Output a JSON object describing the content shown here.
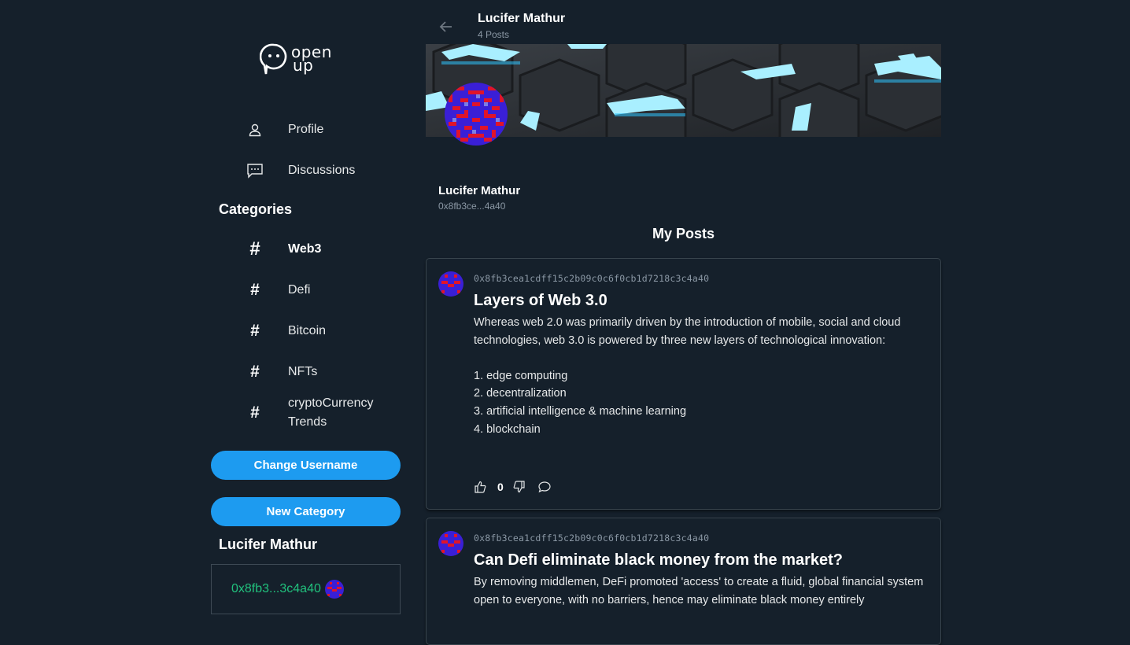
{
  "brand": {
    "logo_text_line1": "open",
    "logo_text_line2": "up"
  },
  "sidebar": {
    "nav": [
      {
        "label": "Profile",
        "icon": "user-icon"
      },
      {
        "label": "Discussions",
        "icon": "chat-icon"
      }
    ],
    "categories_heading": "Categories",
    "categories": [
      {
        "label": "Web3",
        "active": true
      },
      {
        "label": "Defi",
        "active": false
      },
      {
        "label": "Bitcoin",
        "active": false
      },
      {
        "label": "NFTs",
        "active": false
      },
      {
        "label": "cryptoCurrency Trends",
        "active": false
      }
    ],
    "change_username_label": "Change Username",
    "new_category_label": "New Category",
    "user_name": "Lucifer Mathur",
    "wallet_short": "0x8fb3...3c4a40"
  },
  "header": {
    "name": "Lucifer Mathur",
    "post_count": "4 Posts"
  },
  "profile": {
    "name": "Lucifer Mathur",
    "address_short": "0x8fb3ce...4a40"
  },
  "posts_heading": "My Posts",
  "posts": [
    {
      "author_address": "0x8fb3cea1cdff15c2b09c0c6f0cb1d7218c3c4a40",
      "title": "Layers of Web 3.0",
      "body": "Whereas web 2.0 was primarily driven by the introduction of mobile, social and cloud technologies, web 3.0 is powered by three new layers of technological innovation:\n\n1. edge computing\n2. decentralization\n3. artificial intelligence & machine learning\n4. blockchain",
      "likes": "0"
    },
    {
      "author_address": "0x8fb3cea1cdff15c2b09c0c6f0cb1d7218c3c4a40",
      "title": "Can Defi eliminate black money from the market?",
      "body": "By removing middlemen, DeFi promoted 'access' to create a fluid, global financial system open to everyone, with no barriers, hence may eliminate black money entirely"
    }
  ],
  "colors": {
    "accent": "#1d9bf0",
    "background": "#15202b",
    "wallet": "#21c17d"
  }
}
